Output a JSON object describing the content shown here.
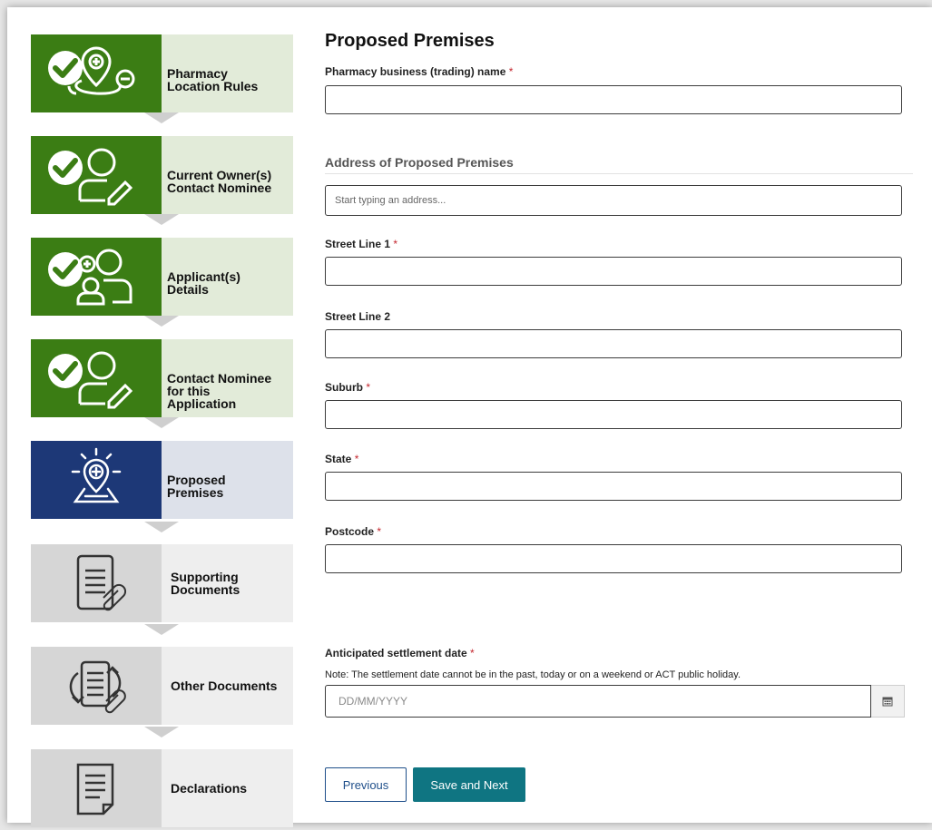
{
  "steps": [
    {
      "label": "Pharmacy\nLocation Rules",
      "status": "done",
      "icon": "location-check-icon"
    },
    {
      "label": "Current Owner(s)\nContact Nominee",
      "status": "done",
      "icon": "owner-contact-check-icon"
    },
    {
      "label": "Applicant(s)\nDetails",
      "status": "done",
      "icon": "applicant-check-icon"
    },
    {
      "label": "Contact Nominee\nfor this\nApplication",
      "status": "done",
      "icon": "nominee-check-icon"
    },
    {
      "label": "Proposed\nPremises",
      "status": "current",
      "icon": "premises-pin-icon"
    },
    {
      "label": "Supporting\nDocuments",
      "status": "todo",
      "icon": "document-attachment-icon"
    },
    {
      "label": "Other Documents",
      "status": "todo",
      "icon": "document-exchange-icon"
    },
    {
      "label": "Declarations",
      "status": "todo",
      "icon": "declaration-document-icon"
    }
  ],
  "form": {
    "title": "Proposed Premises",
    "required_mark": "*",
    "business_name_label": "Pharmacy business (trading) name",
    "business_name_value": "",
    "address_section_title": "Address of Proposed Premises",
    "address_search_placeholder": "Start typing an address...",
    "street1_label": "Street Line 1",
    "street1_value": "",
    "street2_label": "Street Line 2",
    "street2_value": "",
    "suburb_label": "Suburb",
    "suburb_value": "",
    "state_label": "State",
    "state_value": "",
    "postcode_label": "Postcode",
    "postcode_value": "",
    "settlement_label": "Anticipated settlement date",
    "settlement_note": "Note: The settlement date cannot be in the past, today or on a weekend or ACT public holiday.",
    "settlement_placeholder": "DD/MM/YYYY",
    "calendar_icon": "calendar-icon"
  },
  "buttons": {
    "previous": "Previous",
    "save_next": "Save and Next"
  },
  "colors": {
    "done": "#3b7d14",
    "current": "#1d3877",
    "todo": "#d6d6d6",
    "primary_button": "#0f7582",
    "required": "#c4262e"
  }
}
